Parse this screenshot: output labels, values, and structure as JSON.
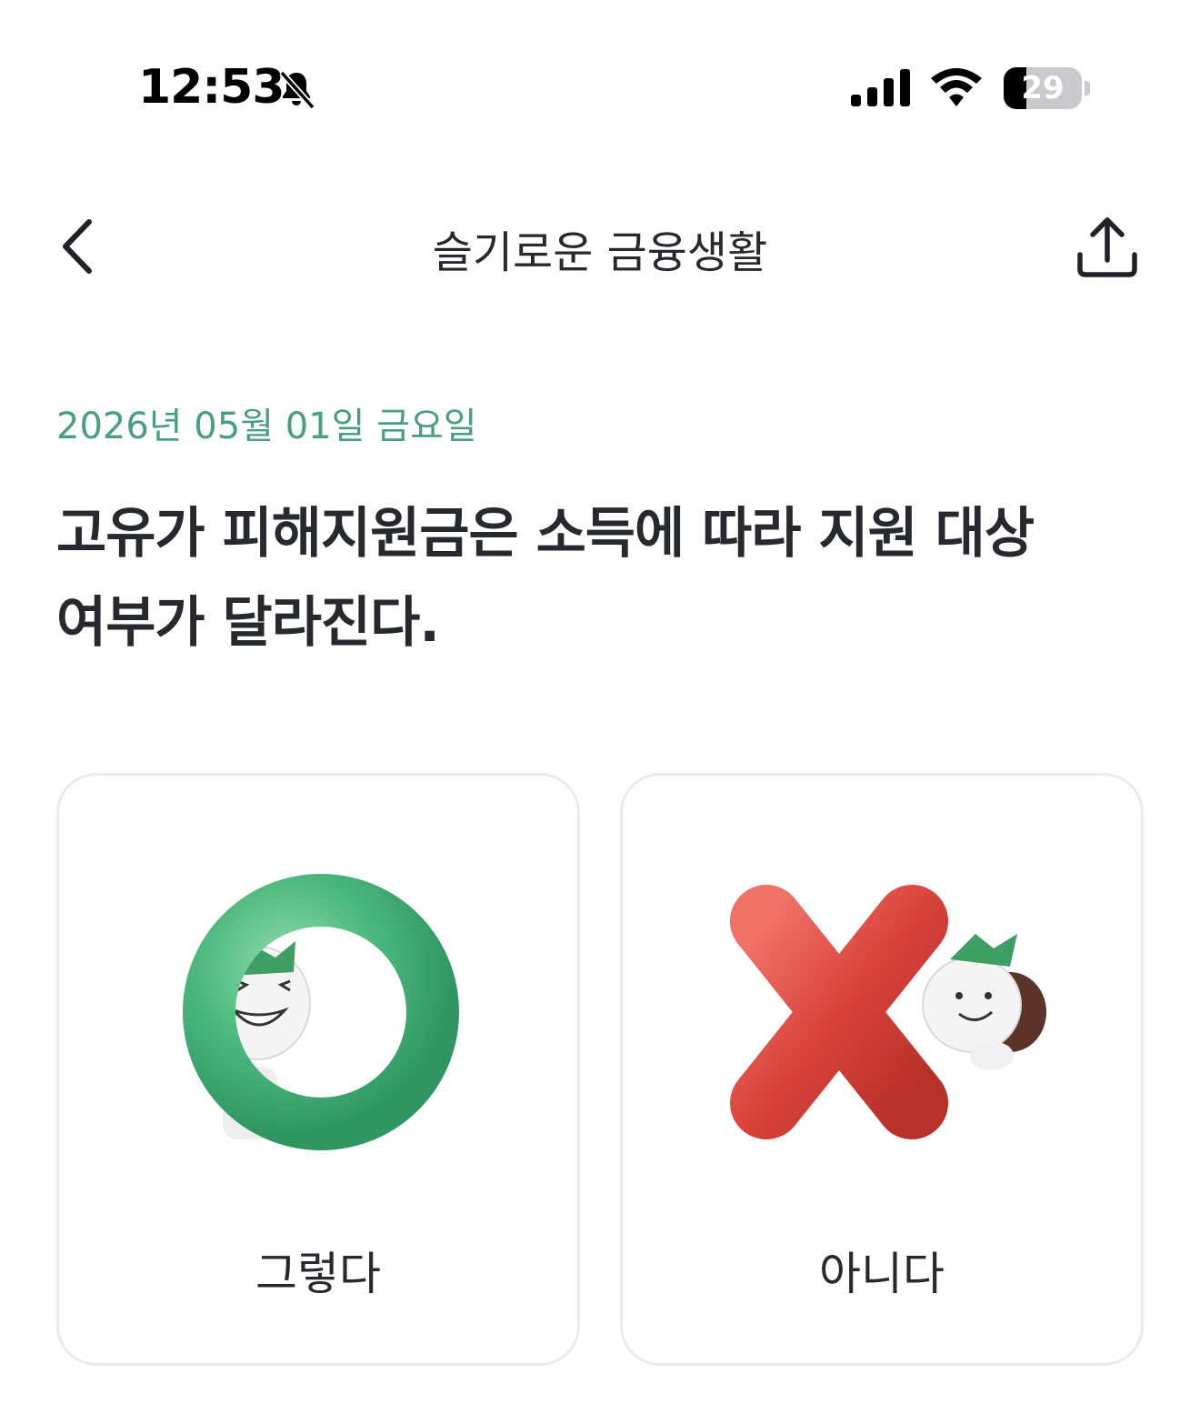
{
  "status_bar": {
    "time": "12:53",
    "battery": "29",
    "battery_level": 0.29
  },
  "nav": {
    "title": "슬기로운 금융생활"
  },
  "content": {
    "date": "2026년 05월 01일 금요일",
    "question_line1": "고유가 피해지원금은 소득에 따라 지원 대상",
    "question_line2": "여부가 달라진다."
  },
  "answers": {
    "yes_label": "그렇다",
    "no_label": "아니다"
  },
  "colors": {
    "accent_date": "#4a9d85",
    "yes_ring": "#4bb77d",
    "no_cross": "#d8423a"
  }
}
